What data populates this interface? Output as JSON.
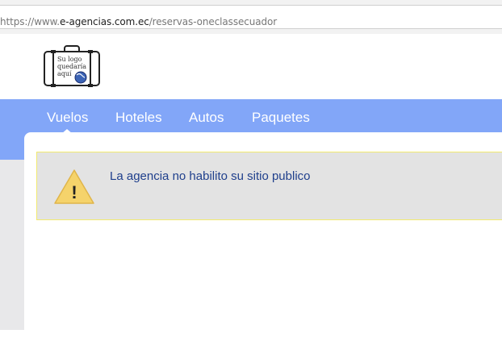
{
  "browser": {
    "url_prefix": "https://www.",
    "url_host": "e-agencias.com.ec",
    "url_path": "/reservas-oneclassecuador"
  },
  "logo": {
    "line1": "Su logo",
    "line2": "quedaría",
    "line3": "aquí"
  },
  "nav": {
    "items": [
      {
        "label": "Vuelos"
      },
      {
        "label": "Hoteles"
      },
      {
        "label": "Autos"
      },
      {
        "label": "Paquetes"
      }
    ],
    "active_index": 0
  },
  "alert": {
    "icon_symbol": "!",
    "message": "La agencia no habilito su sitio publico"
  },
  "colors": {
    "nav_bg": "#82a6f8",
    "alert_bg": "#e3e3e3",
    "alert_border": "#f2ea6f",
    "alert_text": "#1f3f8c",
    "warning_fill": "#f5d36b"
  }
}
